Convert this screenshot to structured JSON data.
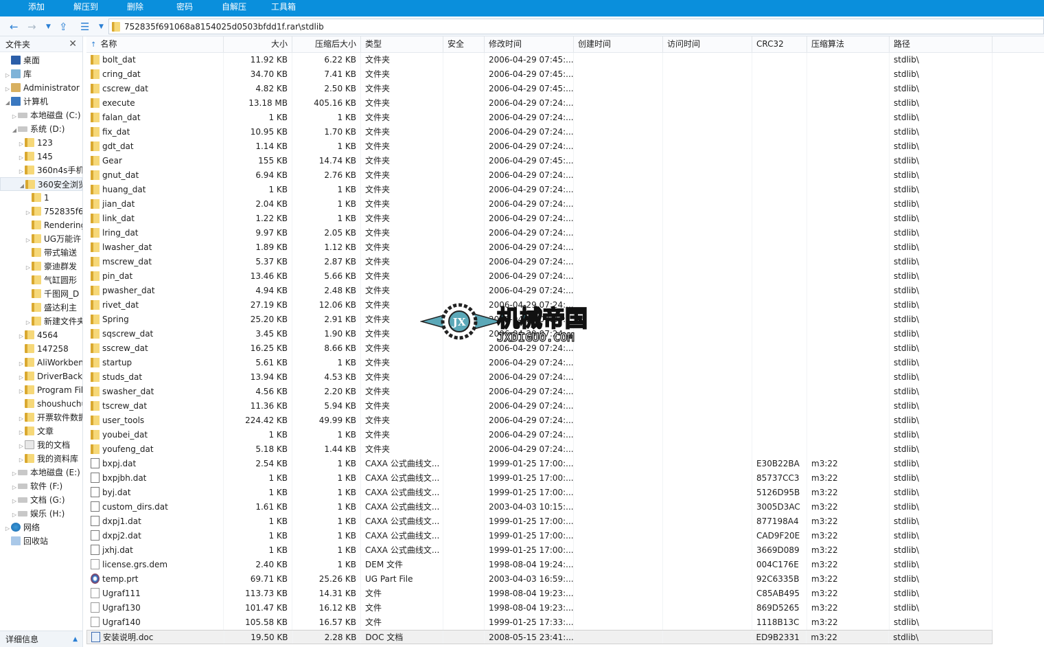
{
  "menu": [
    "添加",
    "解压到",
    "删除",
    "密码",
    "自解压",
    "工具箱"
  ],
  "address": {
    "path": "752835f691068a8154025d0503bfdd1f.rar\\stdlib"
  },
  "sidebar": {
    "title": "文件夹",
    "details_label": "详细信息",
    "items": [
      {
        "label": "桌面",
        "level": 0,
        "icon": "desktop",
        "arrow": ""
      },
      {
        "label": "库",
        "level": 0,
        "icon": "lib",
        "arrow": "▷"
      },
      {
        "label": "Administrator",
        "level": 0,
        "icon": "user",
        "arrow": "▷"
      },
      {
        "label": "计算机",
        "level": 0,
        "icon": "pc",
        "arrow": "◢"
      },
      {
        "label": "本地磁盘 (C:)",
        "level": 1,
        "icon": "drive",
        "arrow": "▷"
      },
      {
        "label": "系统 (D:)",
        "level": 1,
        "icon": "drive",
        "arrow": "◢"
      },
      {
        "label": "123",
        "level": 2,
        "icon": "folder",
        "arrow": "▷"
      },
      {
        "label": "145",
        "level": 2,
        "icon": "folder",
        "arrow": "▷"
      },
      {
        "label": "360n4s手机",
        "level": 2,
        "icon": "folder",
        "arrow": "▷"
      },
      {
        "label": "360安全浏览",
        "level": 2,
        "icon": "folder",
        "arrow": "◢",
        "selected": true
      },
      {
        "label": "1",
        "level": 3,
        "icon": "folder",
        "arrow": ""
      },
      {
        "label": "752835f6",
        "level": 3,
        "icon": "folder",
        "arrow": "▷"
      },
      {
        "label": "Rendering",
        "level": 3,
        "icon": "folder",
        "arrow": ""
      },
      {
        "label": "UG万能许",
        "level": 3,
        "icon": "folder",
        "arrow": "▷"
      },
      {
        "label": "带式输送",
        "level": 3,
        "icon": "folder",
        "arrow": ""
      },
      {
        "label": "豪迪群发",
        "level": 3,
        "icon": "folder",
        "arrow": "▷"
      },
      {
        "label": "气缸圆形",
        "level": 3,
        "icon": "folder",
        "arrow": ""
      },
      {
        "label": "千图网_D",
        "level": 3,
        "icon": "folder",
        "arrow": ""
      },
      {
        "label": "盛达利主",
        "level": 3,
        "icon": "folder",
        "arrow": ""
      },
      {
        "label": "新建文件夹",
        "level": 3,
        "icon": "folder",
        "arrow": "▷"
      },
      {
        "label": "4564",
        "level": 2,
        "icon": "folder",
        "arrow": "▷"
      },
      {
        "label": "147258",
        "level": 2,
        "icon": "folder",
        "arrow": ""
      },
      {
        "label": "AliWorkbench",
        "level": 2,
        "icon": "folder",
        "arrow": "▷"
      },
      {
        "label": "DriverBackup",
        "level": 2,
        "icon": "folder",
        "arrow": "▷"
      },
      {
        "label": "Program Files",
        "level": 2,
        "icon": "folder",
        "arrow": "▷"
      },
      {
        "label": "shoushuchu",
        "level": 2,
        "icon": "folder",
        "arrow": ""
      },
      {
        "label": "开票软件数据",
        "level": 2,
        "icon": "folder",
        "arrow": "▷"
      },
      {
        "label": "文章",
        "level": 2,
        "icon": "folder",
        "arrow": "▷"
      },
      {
        "label": "我的文档",
        "level": 2,
        "icon": "doc",
        "arrow": "▷"
      },
      {
        "label": "我的资料库",
        "level": 2,
        "icon": "folder",
        "arrow": "▷"
      },
      {
        "label": "本地磁盘 (E:)",
        "level": 1,
        "icon": "drive",
        "arrow": "▷"
      },
      {
        "label": "软件 (F:)",
        "level": 1,
        "icon": "drive",
        "arrow": "▷"
      },
      {
        "label": "文档 (G:)",
        "level": 1,
        "icon": "drive",
        "arrow": "▷"
      },
      {
        "label": "娱乐 (H:)",
        "level": 1,
        "icon": "drive",
        "arrow": "▷"
      },
      {
        "label": "网络",
        "level": 0,
        "icon": "net",
        "arrow": "▷"
      },
      {
        "label": "回收站",
        "level": 0,
        "icon": "bin",
        "arrow": ""
      }
    ]
  },
  "columns": [
    "名称",
    "大小",
    "压缩后大小",
    "类型",
    "安全",
    "修改时间",
    "创建时间",
    "访问时间",
    "CRC32",
    "压缩算法",
    "路径"
  ],
  "sort_indicator": "↑",
  "files": [
    [
      "bolt_dat",
      "11.92 KB",
      "6.22 KB",
      "文件夹",
      "",
      "2006-04-29 07:45:...",
      "",
      "",
      "",
      "",
      "stdlib\\",
      "folder"
    ],
    [
      "cring_dat",
      "34.70 KB",
      "7.41 KB",
      "文件夹",
      "",
      "2006-04-29 07:45:...",
      "",
      "",
      "",
      "",
      "stdlib\\",
      "folder"
    ],
    [
      "cscrew_dat",
      "4.82 KB",
      "2.50 KB",
      "文件夹",
      "",
      "2006-04-29 07:45:...",
      "",
      "",
      "",
      "",
      "stdlib\\",
      "folder"
    ],
    [
      "execute",
      "13.18 MB",
      "405.16 KB",
      "文件夹",
      "",
      "2006-04-29 07:24:...",
      "",
      "",
      "",
      "",
      "stdlib\\",
      "folder"
    ],
    [
      "falan_dat",
      "1 KB",
      "1 KB",
      "文件夹",
      "",
      "2006-04-29 07:24:...",
      "",
      "",
      "",
      "",
      "stdlib\\",
      "folder"
    ],
    [
      "fix_dat",
      "10.95 KB",
      "1.70 KB",
      "文件夹",
      "",
      "2006-04-29 07:24:...",
      "",
      "",
      "",
      "",
      "stdlib\\",
      "folder"
    ],
    [
      "gdt_dat",
      "1.14 KB",
      "1 KB",
      "文件夹",
      "",
      "2006-04-29 07:24:...",
      "",
      "",
      "",
      "",
      "stdlib\\",
      "folder"
    ],
    [
      "Gear",
      "155 KB",
      "14.74 KB",
      "文件夹",
      "",
      "2006-04-29 07:45:...",
      "",
      "",
      "",
      "",
      "stdlib\\",
      "folder"
    ],
    [
      "gnut_dat",
      "6.94 KB",
      "2.76 KB",
      "文件夹",
      "",
      "2006-04-29 07:24:...",
      "",
      "",
      "",
      "",
      "stdlib\\",
      "folder"
    ],
    [
      "huang_dat",
      "1 KB",
      "1 KB",
      "文件夹",
      "",
      "2006-04-29 07:24:...",
      "",
      "",
      "",
      "",
      "stdlib\\",
      "folder"
    ],
    [
      "jian_dat",
      "2.04 KB",
      "1 KB",
      "文件夹",
      "",
      "2006-04-29 07:24:...",
      "",
      "",
      "",
      "",
      "stdlib\\",
      "folder"
    ],
    [
      "link_dat",
      "1.22 KB",
      "1 KB",
      "文件夹",
      "",
      "2006-04-29 07:24:...",
      "",
      "",
      "",
      "",
      "stdlib\\",
      "folder"
    ],
    [
      "lring_dat",
      "9.97 KB",
      "2.05 KB",
      "文件夹",
      "",
      "2006-04-29 07:24:...",
      "",
      "",
      "",
      "",
      "stdlib\\",
      "folder"
    ],
    [
      "lwasher_dat",
      "1.89 KB",
      "1.12 KB",
      "文件夹",
      "",
      "2006-04-29 07:24:...",
      "",
      "",
      "",
      "",
      "stdlib\\",
      "folder"
    ],
    [
      "mscrew_dat",
      "5.37 KB",
      "2.87 KB",
      "文件夹",
      "",
      "2006-04-29 07:24:...",
      "",
      "",
      "",
      "",
      "stdlib\\",
      "folder"
    ],
    [
      "pin_dat",
      "13.46 KB",
      "5.66 KB",
      "文件夹",
      "",
      "2006-04-29 07:24:...",
      "",
      "",
      "",
      "",
      "stdlib\\",
      "folder"
    ],
    [
      "pwasher_dat",
      "4.94 KB",
      "2.48 KB",
      "文件夹",
      "",
      "2006-04-29 07:24:...",
      "",
      "",
      "",
      "",
      "stdlib\\",
      "folder"
    ],
    [
      "rivet_dat",
      "27.19 KB",
      "12.06 KB",
      "文件夹",
      "",
      "2006-04-29 07:24:...",
      "",
      "",
      "",
      "",
      "stdlib\\",
      "folder"
    ],
    [
      "Spring",
      "25.20 KB",
      "2.91 KB",
      "文件夹",
      "",
      "2006-04-29 07:24:...",
      "",
      "",
      "",
      "",
      "stdlib\\",
      "folder"
    ],
    [
      "sqscrew_dat",
      "3.45 KB",
      "1.90 KB",
      "文件夹",
      "",
      "2006-04-29 07:24:...",
      "",
      "",
      "",
      "",
      "stdlib\\",
      "folder"
    ],
    [
      "sscrew_dat",
      "16.25 KB",
      "8.66 KB",
      "文件夹",
      "",
      "2006-04-29 07:24:...",
      "",
      "",
      "",
      "",
      "stdlib\\",
      "folder"
    ],
    [
      "startup",
      "5.61 KB",
      "1 KB",
      "文件夹",
      "",
      "2006-04-29 07:24:...",
      "",
      "",
      "",
      "",
      "stdlib\\",
      "folder"
    ],
    [
      "studs_dat",
      "13.94 KB",
      "4.53 KB",
      "文件夹",
      "",
      "2006-04-29 07:24:...",
      "",
      "",
      "",
      "",
      "stdlib\\",
      "folder"
    ],
    [
      "swasher_dat",
      "4.56 KB",
      "2.20 KB",
      "文件夹",
      "",
      "2006-04-29 07:24:...",
      "",
      "",
      "",
      "",
      "stdlib\\",
      "folder"
    ],
    [
      "tscrew_dat",
      "11.36 KB",
      "5.94 KB",
      "文件夹",
      "",
      "2006-04-29 07:24:...",
      "",
      "",
      "",
      "",
      "stdlib\\",
      "folder"
    ],
    [
      "user_tools",
      "224.42 KB",
      "49.99 KB",
      "文件夹",
      "",
      "2006-04-29 07:24:...",
      "",
      "",
      "",
      "",
      "stdlib\\",
      "folder"
    ],
    [
      "youbei_dat",
      "1 KB",
      "1 KB",
      "文件夹",
      "",
      "2006-04-29 07:24:...",
      "",
      "",
      "",
      "",
      "stdlib\\",
      "folder"
    ],
    [
      "youfeng_dat",
      "5.18 KB",
      "1.44 KB",
      "文件夹",
      "",
      "2006-04-29 07:24:...",
      "",
      "",
      "",
      "",
      "stdlib\\",
      "folder"
    ],
    [
      "bxpj.dat",
      "2.54 KB",
      "1 KB",
      "CAXA 公式曲线文...",
      "",
      "1999-01-25 17:00:...",
      "",
      "",
      "E30B22BA",
      "m3:22",
      "stdlib\\",
      "dat"
    ],
    [
      "bxpjbh.dat",
      "1 KB",
      "1 KB",
      "CAXA 公式曲线文...",
      "",
      "1999-01-25 17:00:...",
      "",
      "",
      "85737CC3",
      "m3:22",
      "stdlib\\",
      "dat"
    ],
    [
      "byj.dat",
      "1 KB",
      "1 KB",
      "CAXA 公式曲线文...",
      "",
      "1999-01-25 17:00:...",
      "",
      "",
      "5126D95B",
      "m3:22",
      "stdlib\\",
      "dat"
    ],
    [
      "custom_dirs.dat",
      "1.61 KB",
      "1 KB",
      "CAXA 公式曲线文...",
      "",
      "2003-04-03 10:15:...",
      "",
      "",
      "3005D3AC",
      "m3:22",
      "stdlib\\",
      "dat"
    ],
    [
      "dxpj1.dat",
      "1 KB",
      "1 KB",
      "CAXA 公式曲线文...",
      "",
      "1999-01-25 17:00:...",
      "",
      "",
      "877198A4",
      "m3:22",
      "stdlib\\",
      "dat"
    ],
    [
      "dxpj2.dat",
      "1 KB",
      "1 KB",
      "CAXA 公式曲线文...",
      "",
      "1999-01-25 17:00:...",
      "",
      "",
      "CAD9F20E",
      "m3:22",
      "stdlib\\",
      "dat"
    ],
    [
      "jxhj.dat",
      "1 KB",
      "1 KB",
      "CAXA 公式曲线文...",
      "",
      "1999-01-25 17:00:...",
      "",
      "",
      "3669D089",
      "m3:22",
      "stdlib\\",
      "dat"
    ],
    [
      "license.grs.dem",
      "2.40 KB",
      "1 KB",
      "DEM 文件",
      "",
      "1998-08-04 19:24:...",
      "",
      "",
      "004C176E",
      "m3:22",
      "stdlib\\",
      "file"
    ],
    [
      "temp.prt",
      "69.71 KB",
      "25.26 KB",
      "UG Part File",
      "",
      "2003-04-03 16:59:...",
      "",
      "",
      "92C6335B",
      "m3:22",
      "stdlib\\",
      "ug"
    ],
    [
      "Ugraf111",
      "113.73 KB",
      "14.31 KB",
      "文件",
      "",
      "1998-08-04 19:23:...",
      "",
      "",
      "C85AB495",
      "m3:22",
      "stdlib\\",
      "file"
    ],
    [
      "Ugraf130",
      "101.47 KB",
      "16.12 KB",
      "文件",
      "",
      "1998-08-04 19:23:...",
      "",
      "",
      "869D5265",
      "m3:22",
      "stdlib\\",
      "file"
    ],
    [
      "Ugraf140",
      "105.58 KB",
      "16.57 KB",
      "文件",
      "",
      "1999-01-25 17:33:...",
      "",
      "",
      "1118B13C",
      "m3:22",
      "stdlib\\",
      "file"
    ],
    [
      "安装说明.doc",
      "19.50 KB",
      "2.28 KB",
      "DOC 文档",
      "",
      "2008-05-15 23:41:...",
      "",
      "",
      "ED9B2331",
      "m3:22",
      "stdlib\\",
      "doc"
    ]
  ],
  "selected_row": 40,
  "watermark": {
    "cn": "机械帝国",
    "en": "JXDIGUO.COM",
    "badge": "JX"
  },
  "colors": {
    "menubar": "#0a8fdc",
    "nav": "#2a7fd4",
    "watermark": "#4a9fb0"
  }
}
